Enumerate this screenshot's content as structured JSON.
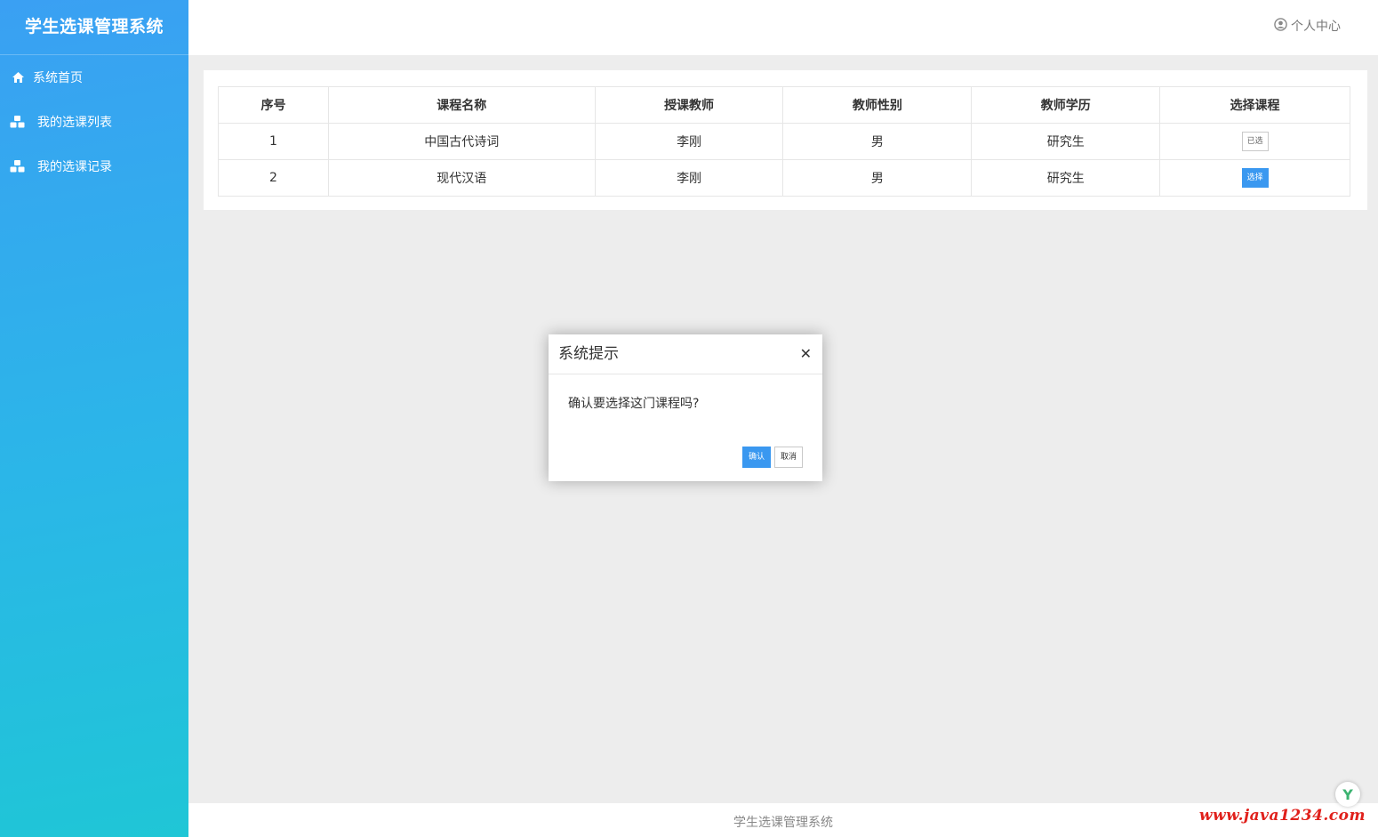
{
  "app": {
    "title": "学生选课管理系统"
  },
  "sidebar": {
    "items": [
      {
        "label": "系统首页",
        "icon": "home-icon"
      },
      {
        "label": "我的选课列表",
        "icon": "cubes-icon"
      },
      {
        "label": "我的选课记录",
        "icon": "cubes-icon"
      }
    ]
  },
  "header": {
    "user_center_label": "个人中心",
    "user_icon": "user-circle-icon"
  },
  "table": {
    "columns": [
      "序号",
      "课程名称",
      "授课教师",
      "教师性别",
      "教师学历",
      "选择课程"
    ],
    "rows": [
      {
        "index": "1",
        "course": "中国古代诗词",
        "teacher": "李刚",
        "gender": "男",
        "degree": "研究生",
        "action": "已选"
      },
      {
        "index": "2",
        "course": "现代汉语",
        "teacher": "李刚",
        "gender": "男",
        "degree": "研究生",
        "action": "选择"
      }
    ]
  },
  "dialog": {
    "title": "系统提示",
    "close_symbol": "✕",
    "message": "确认要选择这门课程吗?",
    "confirm_label": "确认",
    "cancel_label": "取消"
  },
  "footer": {
    "text": "学生选课管理系统"
  },
  "watermark": {
    "text": "www.java1234.com",
    "badge": "Y"
  },
  "colors": {
    "primary": "#3a98f0",
    "sidebar_top": "#3aa0f3",
    "sidebar_bottom": "#1fc6d6"
  }
}
